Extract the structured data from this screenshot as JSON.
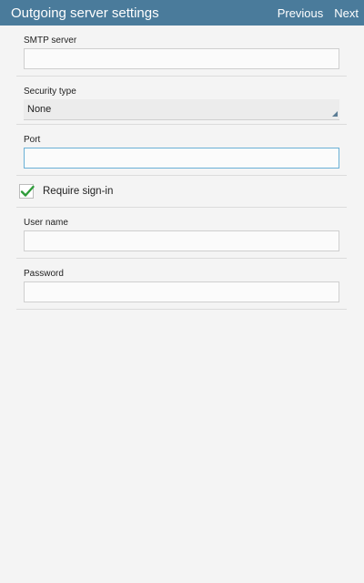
{
  "appbar": {
    "title": "Outgoing server settings",
    "previous_label": "Previous",
    "next_label": "Next"
  },
  "form": {
    "smtp_server": {
      "label": "SMTP server",
      "value": ""
    },
    "security_type": {
      "label": "Security type",
      "value": "None"
    },
    "port": {
      "label": "Port",
      "value": ""
    },
    "require_signin": {
      "label": "Require sign-in",
      "checked": true
    },
    "user_name": {
      "label": "User name",
      "value": ""
    },
    "password": {
      "label": "Password",
      "value": ""
    }
  },
  "colors": {
    "appbar": "#4a7b9b",
    "background": "#f4f4f4",
    "focus_border": "#6ab0d6",
    "check": "#2e9c3a"
  }
}
